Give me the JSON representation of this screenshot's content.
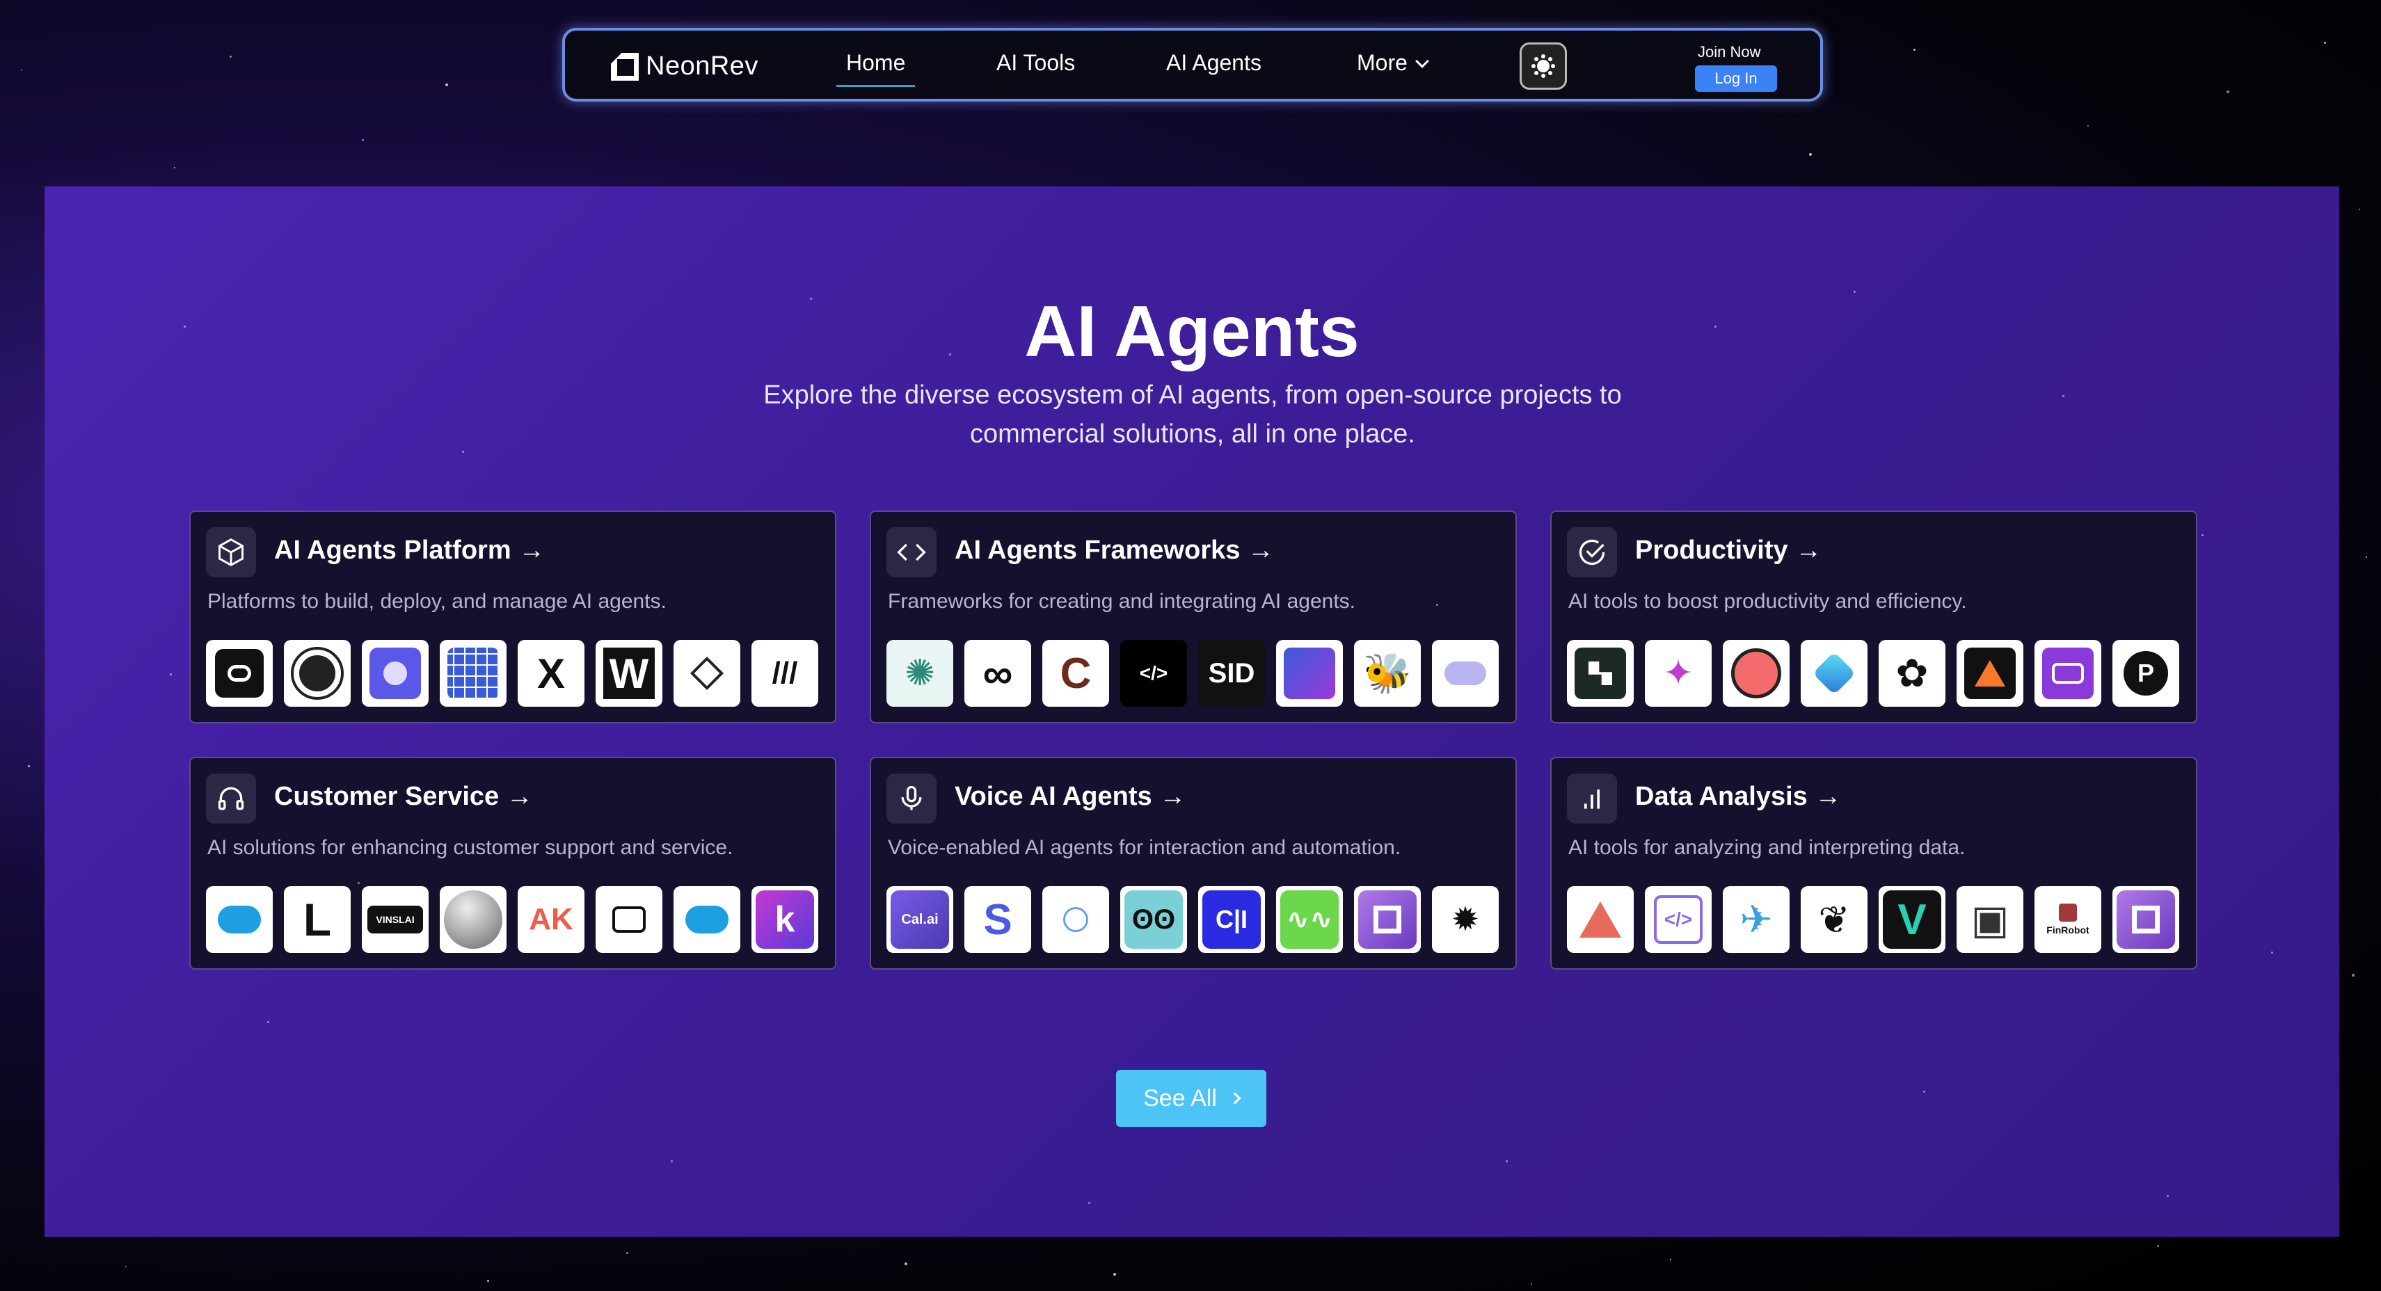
{
  "nav": {
    "brand": "NeonRev",
    "links": [
      {
        "label": "Home",
        "active": true
      },
      {
        "label": "AI Tools",
        "active": false
      },
      {
        "label": "AI Agents",
        "active": false
      },
      {
        "label": "More",
        "active": false
      }
    ],
    "theme_icon": "sun-icon",
    "join_label": "Join Now",
    "login_label": "Log In"
  },
  "hero": {
    "title": "AI Agents",
    "subtitle": "Explore the diverse ecosystem of AI agents, from open-source projects to commercial solutions, all in one place."
  },
  "categories": [
    {
      "title": "AI Agents Platform →",
      "icon": "box-icon",
      "description": "Platforms to build, deploy, and manage AI agents.",
      "logos": [
        "route-logo",
        "aperture-logo",
        "purple-orb-logo",
        "grid-logo",
        "x-logo",
        "w-logo",
        "diamond-logo",
        "slashes-logo"
      ]
    },
    {
      "title": "AI Agents Frameworks →",
      "icon": "code-icon",
      "description": "Frameworks for creating and integrating AI agents.",
      "logos": [
        "octopus-logo",
        "knot-logo",
        "c-swirl-logo",
        "code-tag-logo",
        "SID",
        "gradient-logo",
        "bee-logo",
        "cloud-logo"
      ]
    },
    {
      "title": "Productivity →",
      "icon": "check-circle-icon",
      "description": "AI tools to boost productivity and efficiency.",
      "logos": [
        "blocks-logo",
        "sparkle-logo",
        "whale-logo",
        "blue-diamond-logo",
        "openai-logo",
        "triangle-logo",
        "robot-logo",
        "p-logo"
      ]
    },
    {
      "title": "Customer Service →",
      "icon": "headset-icon",
      "description": "AI solutions for enhancing customer support and service.",
      "logos": [
        "salesforce-logo",
        "L",
        "VINSLAI",
        "sphere-logo",
        "AK",
        "bot-logo",
        "salesforce-logo",
        "k"
      ]
    },
    {
      "title": "Voice AI Agents →",
      "icon": "mic-icon",
      "description": "Voice-enabled AI agents for interaction and automation.",
      "logos": [
        "Cal.ai",
        "S",
        "compass-logo",
        "face-logo",
        "C|I",
        "wave-logo",
        "square-logo",
        "bug-logo"
      ]
    },
    {
      "title": "Data Analysis →",
      "icon": "bar-chart-icon",
      "description": "AI tools for analyzing and interpreting data.",
      "logos": [
        "prism-logo",
        "code-box-logo",
        "bird-logo",
        "parrot-logo",
        "v-logo",
        "box-logo",
        "FinRobot",
        "square-logo"
      ]
    }
  ],
  "see_all_label": "See All"
}
